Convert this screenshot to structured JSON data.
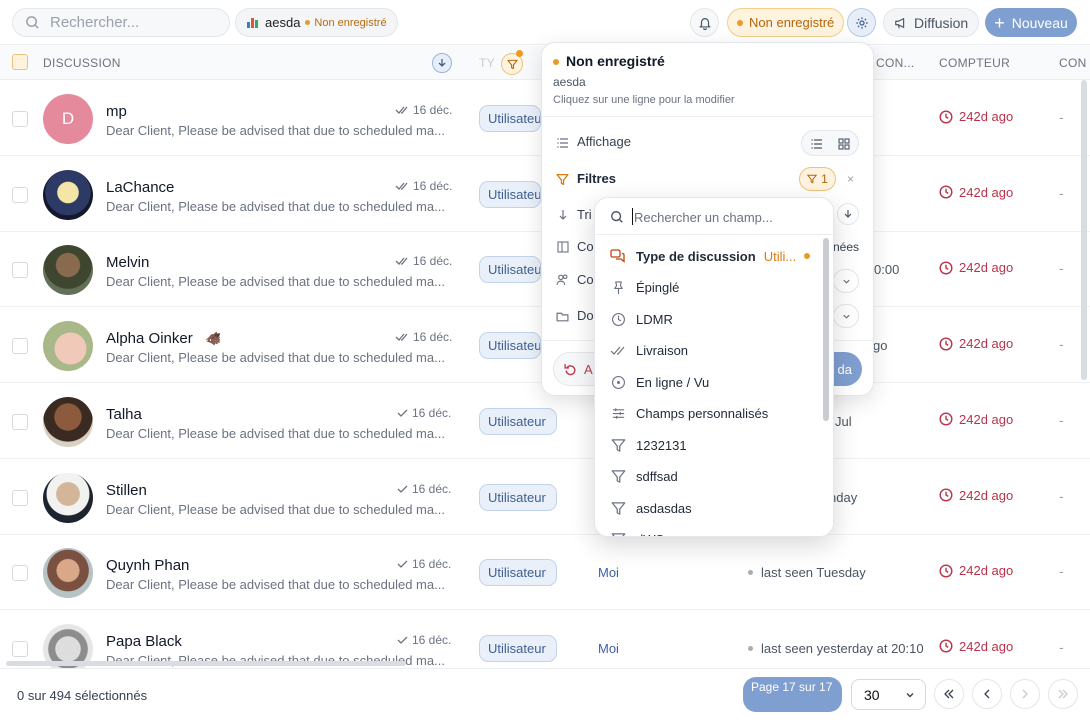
{
  "topbar": {
    "search_placeholder": "Rechercher...",
    "view_name": "aesda",
    "view_status": "Non enregistré",
    "unsaved_badge": "Non enregistré",
    "broadcast_label": "Diffusion",
    "new_label": "Nouveau"
  },
  "table": {
    "headers": {
      "discussion": "DISCUSSION",
      "type": "TY",
      "contact": "CON...",
      "counter": "COMPTEUR",
      "next": "CON"
    },
    "rows": [
      {
        "name": "mp",
        "initial": "D",
        "preview": "Dear Client, Please be advised that due to scheduled ma...",
        "date": "16 déc.",
        "type": "Utilisateur",
        "assignee": "",
        "seen": "",
        "counter": "242d ago",
        "extra": "-",
        "read_double": true
      },
      {
        "name": "LaChance",
        "preview": "Dear Client, Please be advised that due to scheduled ma...",
        "date": "16 déc.",
        "type": "Utilisateur",
        "assignee": "",
        "seen": "",
        "counter": "242d ago",
        "extra": "-",
        "read_double": true
      },
      {
        "name": "Melvin",
        "preview": "Dear Client, Please be advised that due to scheduled ma...",
        "date": "16 déc.",
        "type": "Utilisateur",
        "assignee": "",
        "seen": "0:00",
        "counter": "242d ago",
        "extra": "-",
        "read_double": true
      },
      {
        "name": "Alpha Oinker",
        "emoji": "🐗",
        "preview": "Dear Client, Please be advised that due to scheduled ma...",
        "date": "16 déc.",
        "type": "Utilisateur",
        "assignee": "",
        "seen": "go",
        "counter": "242d ago",
        "extra": "-",
        "read_double": true
      },
      {
        "name": "Talha",
        "preview": "Dear Client, Please be advised that due to scheduled ma...",
        "date": "16 déc.",
        "type": "Utilisateur",
        "assignee": "",
        "seen": "Jul",
        "counter": "242d ago",
        "extra": "-",
        "read_double": false
      },
      {
        "name": "Stillen",
        "preview": "Dear Client, Please be advised that due to scheduled ma...",
        "date": "16 déc.",
        "type": "Utilisateur",
        "assignee": "",
        "seen": "nday",
        "counter": "242d ago",
        "extra": "-",
        "read_double": false
      },
      {
        "name": "Quynh Phan",
        "preview": "Dear Client, Please be advised that due to scheduled ma...",
        "date": "16 déc.",
        "type": "Utilisateur",
        "assignee": "Moi",
        "seen": "last seen Tuesday",
        "counter": "242d ago",
        "extra": "-",
        "read_double": false
      },
      {
        "name": "Papa Black",
        "preview": "Dear Client, Please be advised that due to scheduled ma...",
        "date": "16 déc.",
        "type": "Utilisateur",
        "assignee": "Moi",
        "seen": "last seen yesterday at 20:10",
        "counter": "242d ago",
        "extra": "-",
        "read_double": false
      }
    ]
  },
  "footer": {
    "selection": "0 sur 494 sélectionnés",
    "page_label": "Page 17 sur 17",
    "page_size": "30"
  },
  "view_popover": {
    "title": "Non enregistré",
    "view_name": "aesda",
    "hint": "Cliquez sur une ligne pour la modifier",
    "display_label": "Affichage",
    "filters_label": "Filtres",
    "filter_count": "1",
    "sort_label": "Tri",
    "columns_label": "Col",
    "columns_suffix": "nées",
    "contacts_label": "Co",
    "folder_label": "Dos",
    "reset_label": "A",
    "save_label": "da"
  },
  "field_menu": {
    "search_placeholder": "Rechercher un champ...",
    "items": [
      {
        "label": "Type de discussion",
        "value": "Utili...",
        "icon": "chat-bubbles-icon",
        "active": true
      },
      {
        "label": "Épinglé",
        "icon": "pin-icon"
      },
      {
        "label": "LDMR",
        "icon": "clock-icon"
      },
      {
        "label": "Livraison",
        "icon": "double-check-icon"
      },
      {
        "label": "En ligne / Vu",
        "icon": "online-circle-icon"
      },
      {
        "label": "Champs personnalisés",
        "icon": "sliders-icon"
      },
      {
        "label": "1232131",
        "icon": "funnel-icon"
      },
      {
        "label": "sdffsad",
        "icon": "funnel-icon"
      },
      {
        "label": "asdasdas",
        "icon": "funnel-icon"
      },
      {
        "label": "dWS",
        "icon": "funnel-icon"
      }
    ]
  },
  "colors": {
    "accent": "#7f9fd1",
    "counter": "#b8324a",
    "unsaved": "#eb9a25"
  }
}
